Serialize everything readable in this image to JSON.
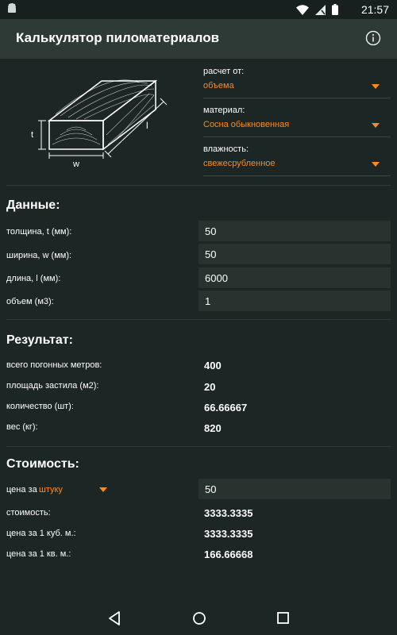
{
  "status_bar": {
    "time": "21:57"
  },
  "app": {
    "title": "Калькулятор пиломатериалов"
  },
  "illustration": {
    "label_t": "t",
    "label_w": "w",
    "label_l": "l"
  },
  "selectors": [
    {
      "label": "расчет от:",
      "value": "объема"
    },
    {
      "label": "материал:",
      "value": "Сосна обыкновенная"
    },
    {
      "label": "влажность:",
      "value": "свежесрубленное"
    }
  ],
  "data_section": {
    "title": "Данные:",
    "rows": [
      {
        "label": "толщина, t (мм):",
        "value": "50"
      },
      {
        "label": "ширина, w (мм):",
        "value": "50"
      },
      {
        "label": "длина, l (мм):",
        "value": "6000"
      },
      {
        "label": "объем (м3):",
        "value": "1"
      }
    ]
  },
  "result_section": {
    "title": "Результат:",
    "rows": [
      {
        "label": "всего погонных метров:",
        "value": "400"
      },
      {
        "label": "площадь застила (м2):",
        "value": "20"
      },
      {
        "label": "количество (шт):",
        "value": "66.66667"
      },
      {
        "label": "вес (кг):",
        "value": "820"
      }
    ]
  },
  "cost_section": {
    "title": "Стоимость:",
    "price_label": "цена за",
    "price_unit": "штуку",
    "price_value": "50",
    "rows": [
      {
        "label": "стоимость:",
        "value": "3333.3335"
      },
      {
        "label": "цена за 1 куб. м.:",
        "value": "3333.3335"
      },
      {
        "label": "цена за 1 кв. м.:",
        "value": "166.66668"
      }
    ]
  },
  "colors": {
    "accent": "#ff8a1e",
    "background": "#1c2624",
    "appbar": "#2d3a36",
    "field": "#28332f"
  }
}
